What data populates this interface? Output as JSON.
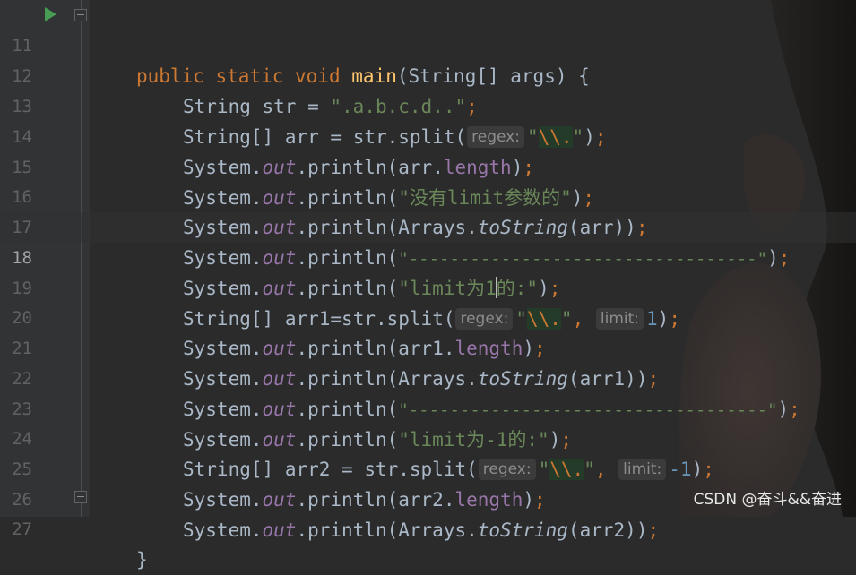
{
  "editor": {
    "lines": [
      {
        "number": "11"
      },
      {
        "number": "12"
      },
      {
        "number": "13"
      },
      {
        "number": "14"
      },
      {
        "number": "15"
      },
      {
        "number": "16"
      },
      {
        "number": "17"
      },
      {
        "number": "18"
      },
      {
        "number": "19"
      },
      {
        "number": "20"
      },
      {
        "number": "21"
      },
      {
        "number": "22"
      },
      {
        "number": "23"
      },
      {
        "number": "24"
      },
      {
        "number": "25"
      },
      {
        "number": "26"
      },
      {
        "number": "27"
      }
    ],
    "current_line": "18",
    "tokens": {
      "public": "public",
      "static": "static",
      "void": "void",
      "main": "main",
      "main_params": "(String[] args) {",
      "string_type": "String",
      "string_arr_type": "String[]",
      "str": "str",
      "arr": "arr",
      "arr1": "arr1",
      "arr2": "arr2",
      "assign": " = ",
      "assign_tight": "=",
      "system": "System.",
      "out": "out",
      "println": ".println(",
      "split_str": "str.split(",
      "arrays": "Arrays.",
      "to_string": "toString",
      "length": "length",
      "semicolon": ";",
      "close_paren_semi": ");",
      "close_paren": ")",
      "double_close": "));",
      "open_paren": "(",
      "comma": ",",
      "dot": ".",
      "quote": "\"",
      "escape": "\\\\.",
      "close_brace": "}",
      "str_value": "\".a.b.c.d..\"",
      "msg_no_limit": "\"没有limit参数的\"",
      "dashes_1": "\"----------------------------------\"",
      "msg_limit1_a": "\"limit为1",
      "msg_limit1_b": "的:\"",
      "dashes_2": "\"-----------------------------------\"",
      "msg_limit_neg1": "\"limit为-1的:\"",
      "num_1": "1",
      "num_neg1": "-1"
    },
    "hints": {
      "regex": "regex:",
      "limit": "limit:"
    }
  },
  "watermark": "CSDN @奋斗&&奋进",
  "colors": {
    "background": "#2b2b2b",
    "keyword": "#cc7832",
    "method_decl": "#ffc66d",
    "string": "#6a8759",
    "field": "#9876aa",
    "number": "#6897bb",
    "text": "#a9b7c6",
    "run_icon": "#499c54"
  },
  "icons": {
    "gutter_run": "run-triangle-icon",
    "fold_start": "fold-marker-icon",
    "fold_end": "fold-marker-icon"
  }
}
